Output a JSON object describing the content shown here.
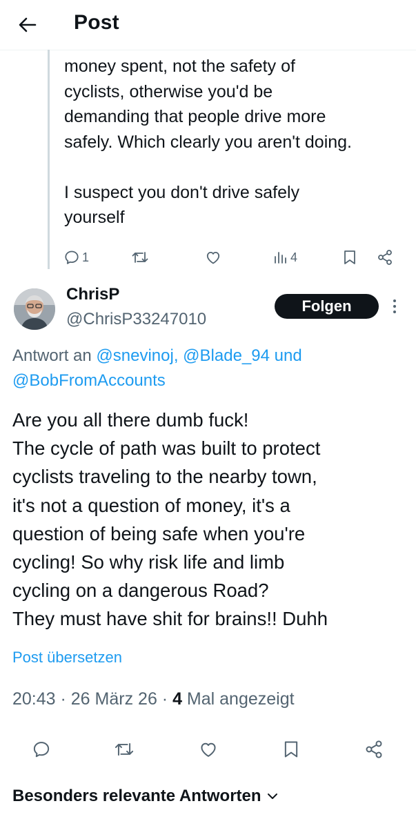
{
  "header": {
    "title": "Post",
    "back_icon": "arrow-left-icon"
  },
  "parent_post": {
    "text": "money spent, not the safety of\ncyclists, otherwise you'd be\ndemanding that people drive more\nsafely. Which clearly you aren't doing.\n\nI suspect you don't drive safely\nyourself",
    "reply_count": "1",
    "view_count": "4"
  },
  "post": {
    "author_name": "ChrisP",
    "author_handle": "@ChrisP33247010",
    "follow_label": "Folgen",
    "reply_prefix": "Antwort an",
    "mention_1": "@snevinoj,",
    "mention_2": "@Blade_94",
    "mention_joiner": "und",
    "mention_3": "@BobFromAccounts",
    "text": "Are you all there dumb fuck!\nThe cycle of path was built to protect\ncyclists traveling to the nearby town,\nit's not a question of money, it's a\nquestion of being safe when you're\ncycling! So why risk life and limb\ncycling on a dangerous Road?\nThey must have shit for brains!! Duhh",
    "translate_label": "Post übersetzen",
    "time": "20:43",
    "date": "26 März 26",
    "views": "4",
    "views_label": "Mal angezeigt"
  },
  "sort": {
    "label": "Besonders relevante Antworten"
  },
  "colors": {
    "accent": "#1d9bf0",
    "text": "#0f1419",
    "muted": "#536471"
  }
}
